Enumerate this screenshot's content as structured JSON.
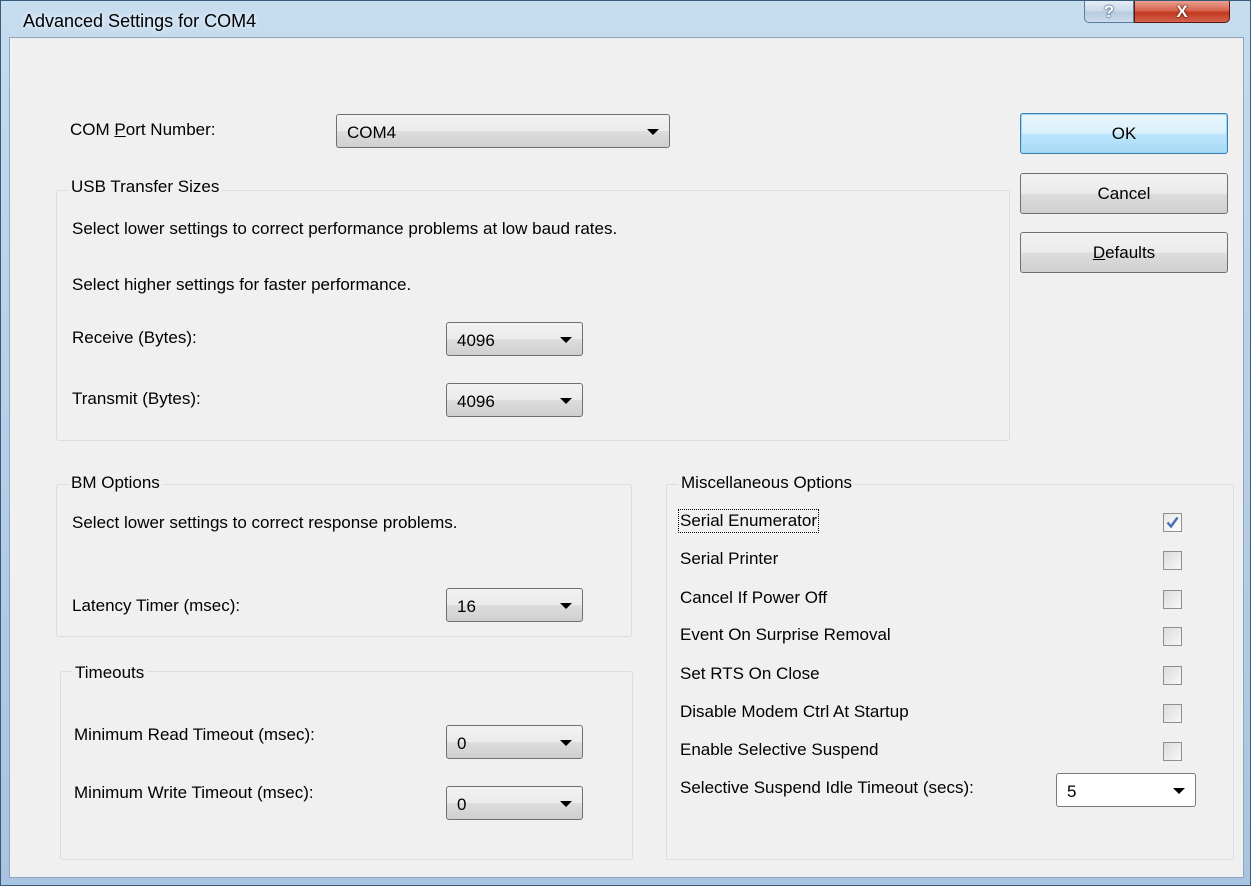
{
  "window": {
    "title": "Advanced Settings for COM4",
    "help_glyph": "?",
    "close_glyph": "X"
  },
  "com_port": {
    "label_pre": "COM ",
    "label_mnemonic": "P",
    "label_post": "ort Number:",
    "value": "COM4"
  },
  "usb_transfer": {
    "title": "USB Transfer Sizes",
    "hint1": "Select lower settings to correct performance problems at low baud rates.",
    "hint2": "Select higher settings for faster performance.",
    "receive_label": "Receive (Bytes):",
    "receive_value": "4096",
    "transmit_label": "Transmit (Bytes):",
    "transmit_value": "4096"
  },
  "bm_options": {
    "title": "BM Options",
    "hint": "Select lower settings to correct response problems.",
    "latency_label": "Latency Timer (msec):",
    "latency_value": "16"
  },
  "timeouts": {
    "title": "Timeouts",
    "min_read_label": "Minimum Read Timeout (msec):",
    "min_read_value": "0",
    "min_write_label": "Minimum Write Timeout (msec):",
    "min_write_value": "0"
  },
  "misc": {
    "title": "Miscellaneous Options",
    "options": [
      {
        "label": "Serial Enumerator",
        "checked": true
      },
      {
        "label": "Serial Printer",
        "checked": false
      },
      {
        "label": "Cancel If Power Off",
        "checked": false
      },
      {
        "label": "Event On Surprise Removal",
        "checked": false
      },
      {
        "label": "Set RTS On Close",
        "checked": false
      },
      {
        "label": "Disable Modem Ctrl At Startup",
        "checked": false
      },
      {
        "label": "Enable Selective Suspend",
        "checked": false
      }
    ],
    "idle_timeout_label": "Selective Suspend Idle Timeout (secs):",
    "idle_timeout_value": "5"
  },
  "buttons": {
    "ok": "OK",
    "cancel": "Cancel",
    "defaults_mnemonic": "D",
    "defaults_rest": "efaults"
  },
  "colors": {
    "check_mark": "#4a6fb5",
    "default_button_border": "#3c7fb1"
  }
}
